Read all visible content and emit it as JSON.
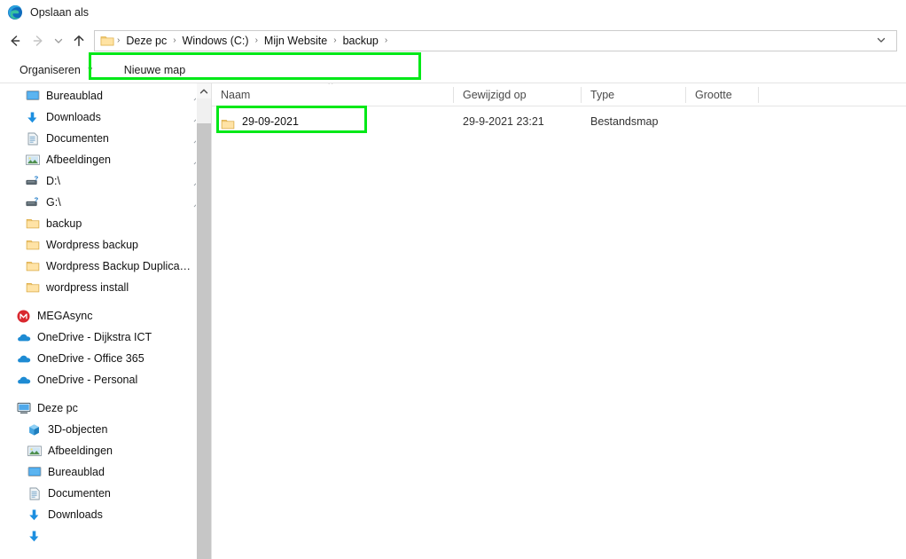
{
  "window": {
    "title": "Opslaan als",
    "icon": "edge-browser-icon"
  },
  "navbar": {
    "back_icon": "arrow-left-icon",
    "forward_icon": "arrow-right-icon",
    "recent_icon": "chevron-down-icon",
    "up_icon": "arrow-up-icon",
    "address_dropdown_icon": "chevron-down-icon",
    "breadcrumbs": [
      {
        "label": "Deze pc"
      },
      {
        "label": "Windows (C:)"
      },
      {
        "label": "Mijn Website"
      },
      {
        "label": "backup"
      }
    ],
    "separator": "›"
  },
  "commandbar": {
    "organize_label": "Organiseren",
    "organize_caret": "▼",
    "new_folder_label": "Nieuwe map"
  },
  "sidebar": {
    "quick_access": [
      {
        "label": "Bureaublad",
        "icon": "desktop-icon",
        "pinned": true,
        "indent": 0
      },
      {
        "label": "Downloads",
        "icon": "download-icon",
        "pinned": true,
        "indent": 0
      },
      {
        "label": "Documenten",
        "icon": "document-icon",
        "pinned": true,
        "indent": 0
      },
      {
        "label": "Afbeeldingen",
        "icon": "pictures-icon",
        "pinned": true,
        "indent": 0
      },
      {
        "label": "D:\\",
        "icon": "drive-unknown-icon",
        "pinned": true,
        "indent": 0
      },
      {
        "label": "G:\\",
        "icon": "drive-unknown-icon",
        "pinned": true,
        "indent": 0
      },
      {
        "label": "backup",
        "icon": "folder-icon",
        "pinned": false,
        "indent": 0
      },
      {
        "label": "Wordpress backup",
        "icon": "folder-icon",
        "pinned": false,
        "indent": 0
      },
      {
        "label": "Wordpress Backup Duplicator",
        "icon": "folder-icon",
        "pinned": false,
        "indent": 0
      },
      {
        "label": "wordpress install",
        "icon": "folder-icon",
        "pinned": false,
        "indent": 0
      }
    ],
    "cloud": [
      {
        "label": "MEGAsync",
        "icon": "mega-icon",
        "indent": 1
      },
      {
        "label": "OneDrive - Dijkstra ICT",
        "icon": "onedrive-icon",
        "indent": 1
      },
      {
        "label": "OneDrive - Office 365",
        "icon": "onedrive-icon",
        "indent": 1
      },
      {
        "label": "OneDrive - Personal",
        "icon": "onedrive-icon",
        "indent": 1
      }
    ],
    "this_pc": {
      "label": "Deze pc",
      "icon": "this-pc-icon",
      "children": [
        {
          "label": "3D-objecten",
          "icon": "cube-icon"
        },
        {
          "label": "Afbeeldingen",
          "icon": "pictures-icon"
        },
        {
          "label": "Bureaublad",
          "icon": "desktop-icon"
        },
        {
          "label": "Documenten",
          "icon": "document-icon"
        },
        {
          "label": "Downloads",
          "icon": "download-icon"
        }
      ]
    },
    "scrollbar": {
      "up_icon": "chevron-up-icon"
    }
  },
  "filelist": {
    "columns": [
      {
        "label": "Naam",
        "sorted": true
      },
      {
        "label": "Gewijzigd op",
        "sorted": false
      },
      {
        "label": "Type",
        "sorted": false
      },
      {
        "label": "Grootte",
        "sorted": false
      }
    ],
    "sort_caret": "˄",
    "rows": [
      {
        "name": "29-09-2021",
        "modified": "29-9-2021 23:21",
        "type": "Bestandsmap",
        "size": "",
        "icon": "folder-icon"
      }
    ]
  },
  "annotations": {
    "accent_color": "#00e817",
    "address_highlight": "breadcrumb-path-highlight",
    "row_highlight": "selected-folder-highlight"
  }
}
